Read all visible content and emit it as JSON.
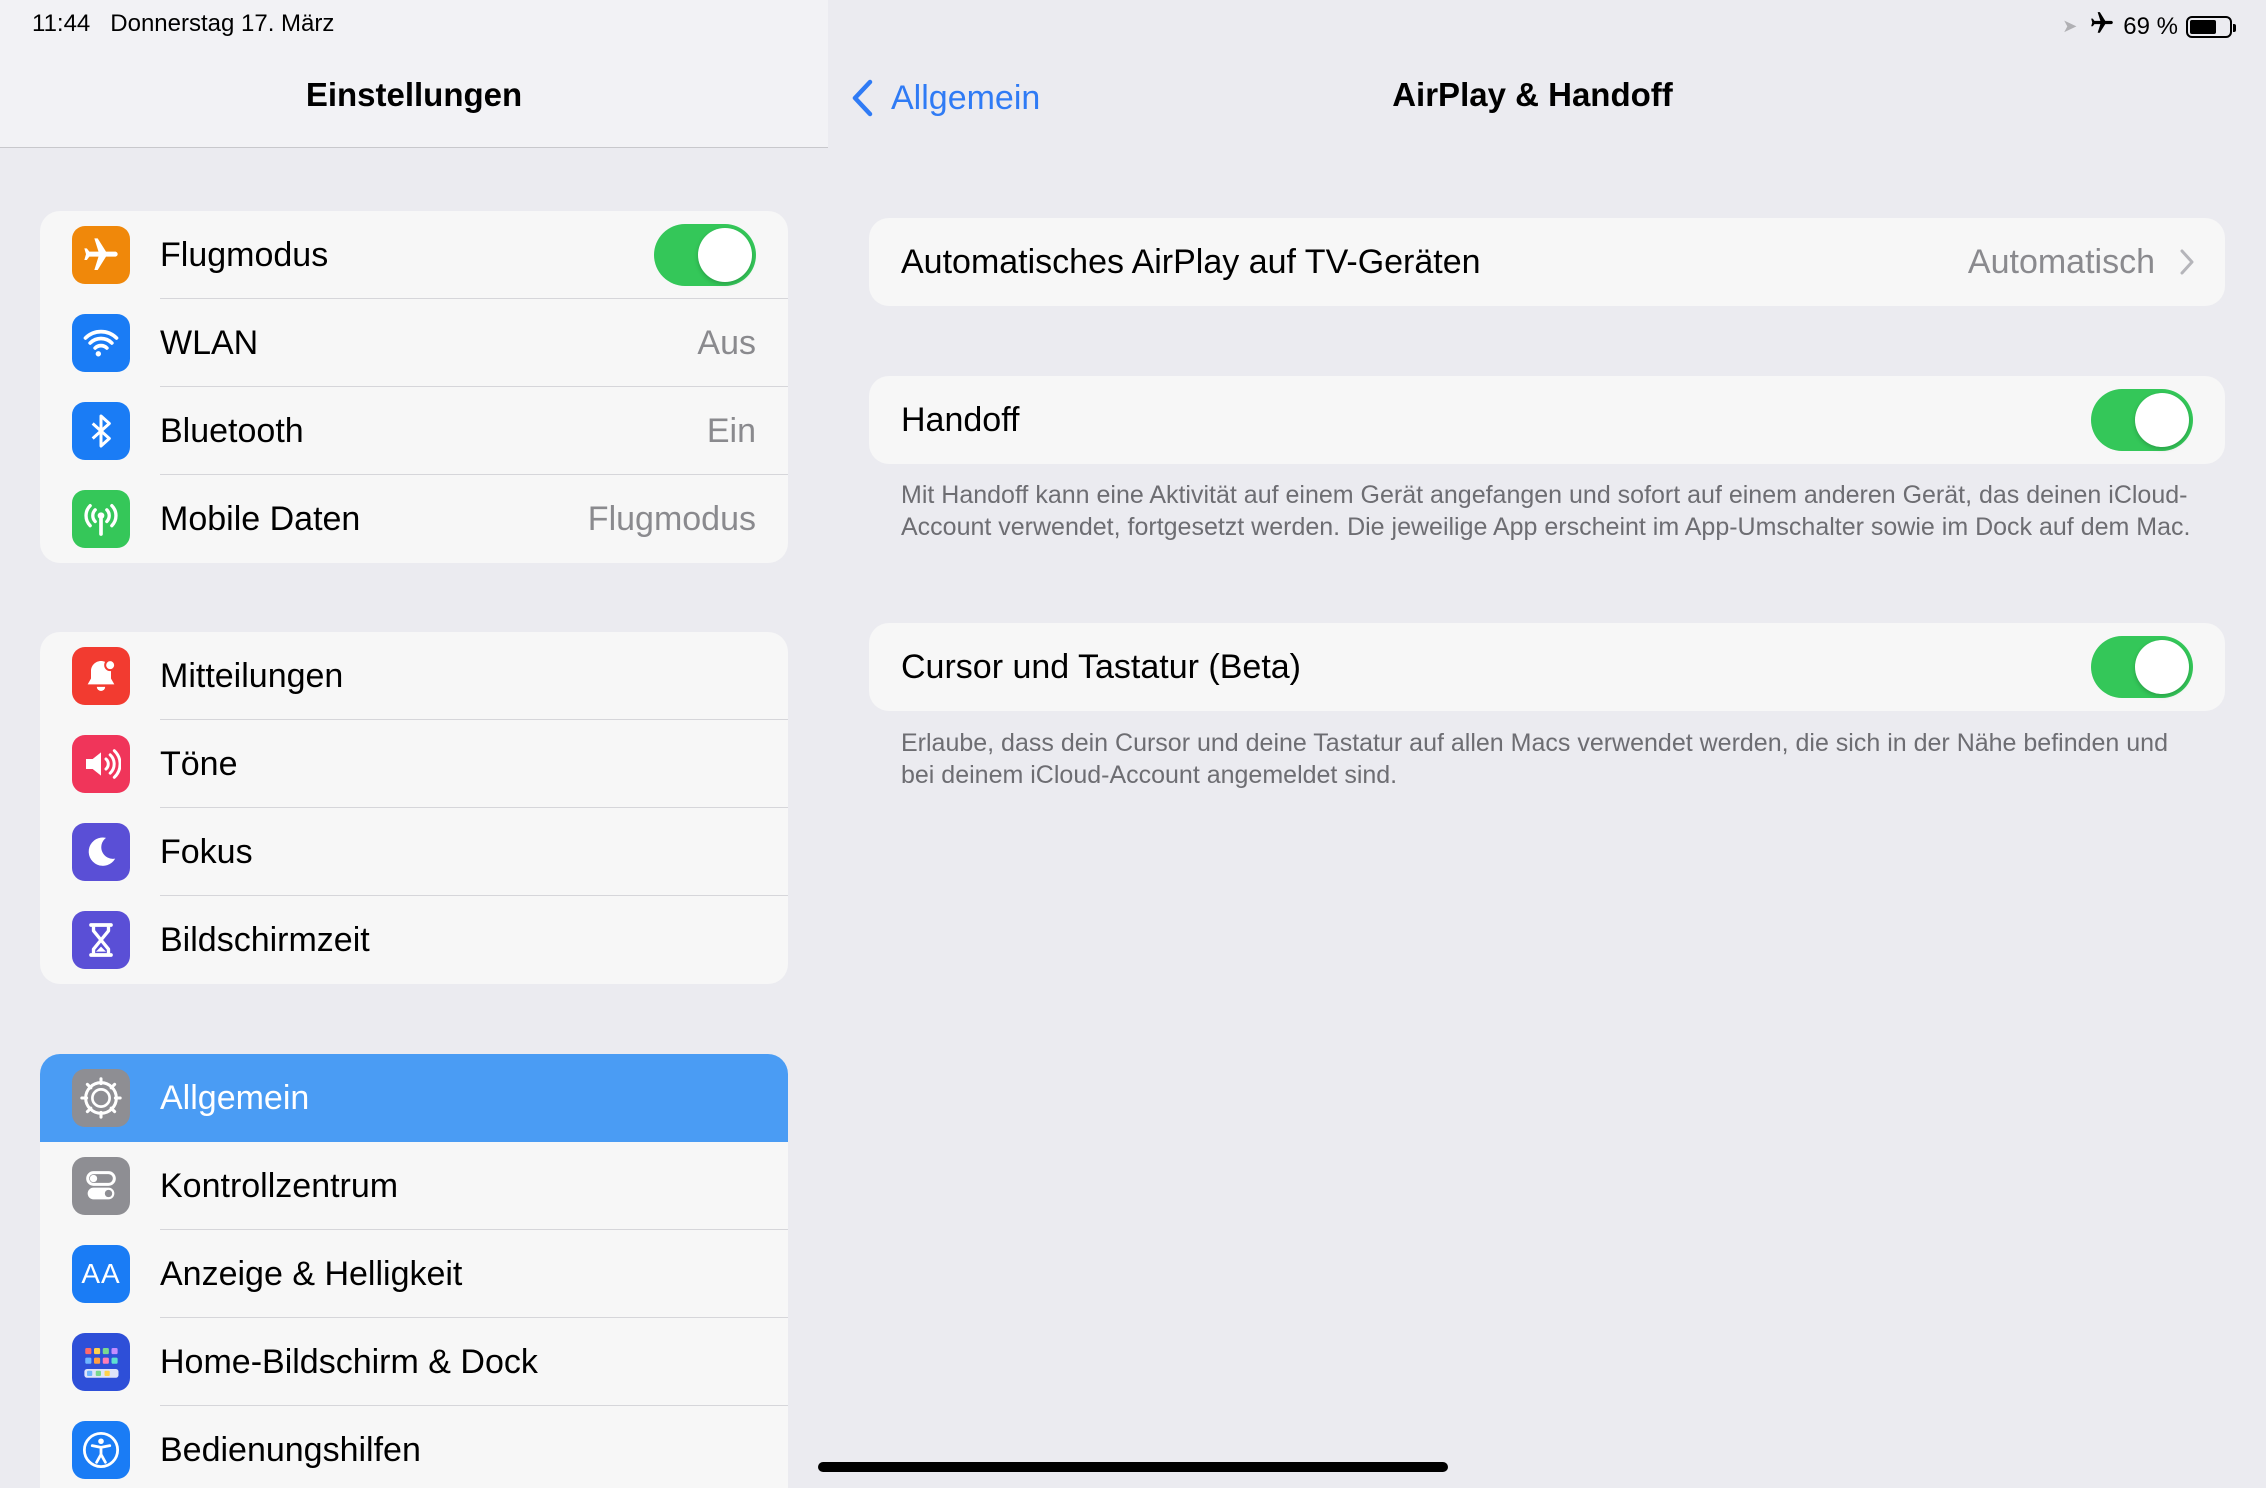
{
  "status": {
    "time": "11:44",
    "date": "Donnerstag 17. März",
    "battery": "69 %",
    "battery_level": 0.69
  },
  "sidebar": {
    "title": "Einstellungen",
    "groups": [
      {
        "items": [
          {
            "label": "Flugmodus",
            "icon": "airplane-icon",
            "icon_color": "#f0880a",
            "toggle": true
          },
          {
            "label": "WLAN",
            "icon": "wifi-icon",
            "icon_color": "#1a7cf5",
            "value": "Aus"
          },
          {
            "label": "Bluetooth",
            "icon": "bluetooth-icon",
            "icon_color": "#1a7cf5",
            "value": "Ein"
          },
          {
            "label": "Mobile Daten",
            "icon": "antenna-icon",
            "icon_color": "#35c759",
            "value": "Flugmodus"
          }
        ]
      },
      {
        "items": [
          {
            "label": "Mitteilungen",
            "icon": "notification-icon",
            "icon_color": "#f23b30"
          },
          {
            "label": "Töne",
            "icon": "speaker-icon",
            "icon_color": "#f0355a"
          },
          {
            "label": "Fokus",
            "icon": "moon-icon",
            "icon_color": "#5a4fd6"
          },
          {
            "label": "Bildschirmzeit",
            "icon": "hourglass-icon",
            "icon_color": "#5a4fd6"
          }
        ]
      },
      {
        "items": [
          {
            "label": "Allgemein",
            "icon": "gear-icon",
            "icon_color": "#8e8e93",
            "selected": true
          },
          {
            "label": "Kontrollzentrum",
            "icon": "switches-icon",
            "icon_color": "#8e8e93"
          },
          {
            "label": "Anzeige & Helligkeit",
            "icon": "text-size-icon",
            "icon_color": "#1a7cf5",
            "icon_text": "AA"
          },
          {
            "label": "Home-Bildschirm & Dock",
            "icon": "app-grid-icon",
            "icon_color": "#2e4fd8"
          },
          {
            "label": "Bedienungshilfen",
            "icon": "accessibility-icon",
            "icon_color": "#1a7cf5"
          }
        ]
      }
    ]
  },
  "detail": {
    "back_label": "Allgemein",
    "title": "AirPlay & Handoff",
    "airplay": {
      "label": "Automatisches AirPlay auf TV-Geräten",
      "value": "Automatisch"
    },
    "handoff": {
      "label": "Handoff",
      "enabled": true,
      "footer": "Mit Handoff kann eine Aktivität auf einem Gerät angefangen und sofort auf einem anderen Gerät, das deinen iCloud-Account verwendet, fortgesetzt werden. Die jeweilige App erscheint im App-Umschalter sowie im Dock auf dem Mac."
    },
    "cursor": {
      "label": "Cursor und Tastatur (Beta)",
      "enabled": true,
      "footer": "Erlaube, dass dein Cursor und deine Tastatur auf allen Macs verwendet werden, die sich in der Nähe befinden und bei deinem iCloud-Account angemeldet sind."
    }
  },
  "colors": {
    "accent": "#2f7bf5",
    "selected_row": "#4a9cf4",
    "toggle_on": "#34c759"
  }
}
